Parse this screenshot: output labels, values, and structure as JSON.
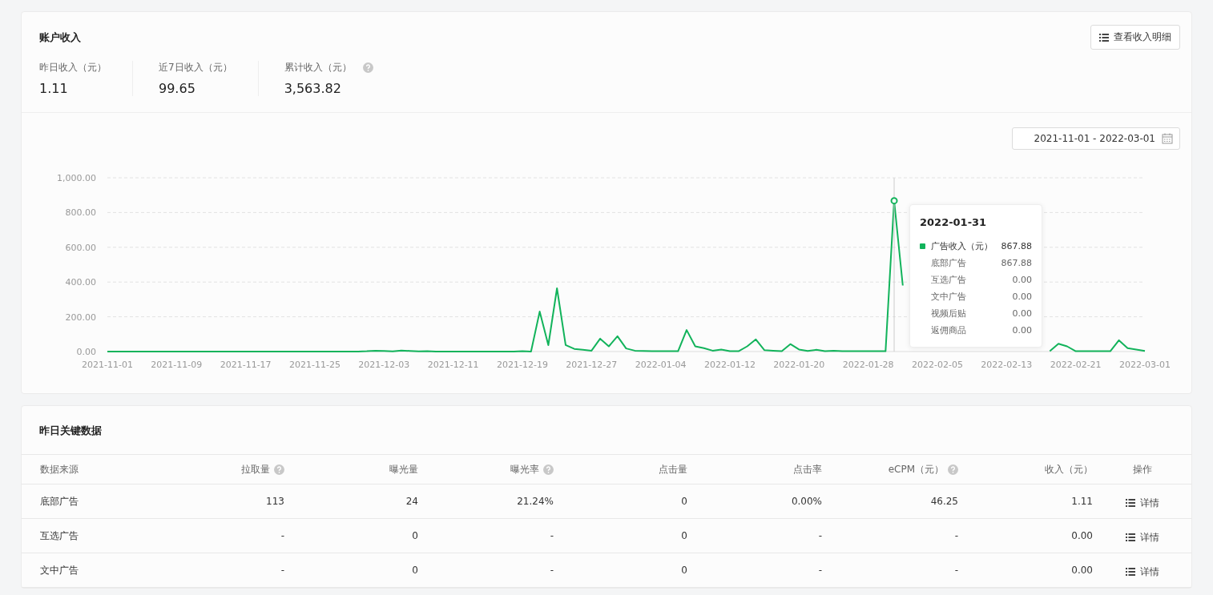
{
  "income_card": {
    "title": "账户收入",
    "detail_button": "查看收入明细",
    "stats": [
      {
        "label": "昨日收入（元）",
        "value": "1.11",
        "help": false
      },
      {
        "label": "近7日收入（元）",
        "value": "99.65",
        "help": false
      },
      {
        "label": "累计收入（元）",
        "value": "3,563.82",
        "help": true
      }
    ],
    "date_range": "2021-11-01 - 2022-03-01",
    "chart_data": {
      "type": "line",
      "ylim": [
        0,
        1000
      ],
      "grid": true,
      "yticks": [
        {
          "value": 0,
          "label": "0.00"
        },
        {
          "value": 200,
          "label": "200.00"
        },
        {
          "value": 400,
          "label": "400.00"
        },
        {
          "value": 600,
          "label": "600.00"
        },
        {
          "value": 800,
          "label": "800.00"
        },
        {
          "value": 1000,
          "label": "1,000.00"
        }
      ],
      "categories": [
        "2021-11-01",
        null,
        null,
        null,
        null,
        null,
        null,
        null,
        "2021-11-09",
        null,
        null,
        null,
        null,
        null,
        null,
        null,
        "2021-11-17",
        null,
        null,
        null,
        null,
        null,
        null,
        null,
        "2021-11-25",
        null,
        null,
        null,
        null,
        null,
        null,
        null,
        "2021-12-03",
        null,
        null,
        null,
        null,
        null,
        null,
        null,
        "2021-12-11",
        null,
        null,
        null,
        null,
        null,
        null,
        null,
        "2021-12-19",
        null,
        null,
        null,
        null,
        null,
        null,
        null,
        "2021-12-27",
        null,
        null,
        null,
        null,
        null,
        null,
        null,
        "2022-01-04",
        null,
        null,
        null,
        null,
        null,
        null,
        null,
        "2022-01-12",
        null,
        null,
        null,
        null,
        null,
        null,
        null,
        "2022-01-20",
        null,
        null,
        null,
        null,
        null,
        null,
        null,
        "2022-01-28",
        null,
        null,
        null,
        null,
        null,
        null,
        null,
        "2022-02-05",
        null,
        null,
        null,
        null,
        null,
        null,
        null,
        "2022-02-13",
        null,
        null,
        null,
        null,
        null,
        null,
        null,
        "2022-02-21",
        null,
        null,
        null,
        null,
        null,
        null,
        null,
        "2022-03-01"
      ],
      "series": [
        {
          "name": "广告收入（元）",
          "color": "#12b35b",
          "values": [
            0,
            0,
            0,
            0,
            0,
            0,
            0,
            0,
            0,
            0,
            0,
            0,
            0,
            0,
            0,
            0,
            0,
            0,
            0,
            0,
            0,
            0,
            0,
            0,
            0,
            0,
            0,
            0,
            0,
            0,
            2,
            5,
            3,
            1,
            6,
            3,
            1,
            2,
            0,
            0,
            0,
            0,
            0,
            0,
            0,
            0,
            0,
            0,
            2,
            0,
            230,
            37,
            364,
            38,
            15,
            10,
            5,
            74,
            30,
            88,
            18,
            5,
            3,
            2,
            2,
            2,
            2,
            124,
            30,
            20,
            5,
            12,
            2,
            2,
            30,
            70,
            8,
            5,
            2,
            43,
            12,
            3,
            10,
            2,
            5,
            2,
            2,
            2,
            2,
            2,
            2,
            867.88,
            380,
            null,
            null,
            null,
            null,
            null,
            null,
            null,
            null,
            null,
            null,
            null,
            null,
            null,
            null,
            null,
            null,
            2,
            45,
            30,
            2,
            2,
            2,
            2,
            2,
            65,
            20,
            12,
            3
          ]
        }
      ]
    },
    "tooltip": {
      "date": "2022-01-31",
      "rows": [
        {
          "kind": "series",
          "value": "867.88"
        },
        {
          "kind": "item",
          "label": "底部广告",
          "value": "867.88"
        },
        {
          "kind": "item",
          "label": "互选广告",
          "value": "0.00"
        },
        {
          "kind": "item",
          "label": "文中广告",
          "value": "0.00"
        },
        {
          "kind": "item",
          "label": "视频后贴",
          "value": "0.00"
        },
        {
          "kind": "item",
          "label": "返佣商品",
          "value": "0.00"
        }
      ]
    }
  },
  "key_data_card": {
    "title": "昨日关键数据",
    "columns": [
      {
        "label": "数据来源",
        "help": false
      },
      {
        "label": "拉取量",
        "help": true
      },
      {
        "label": "曝光量",
        "help": false
      },
      {
        "label": "曝光率",
        "help": true
      },
      {
        "label": "点击量",
        "help": false
      },
      {
        "label": "点击率",
        "help": false
      },
      {
        "label": "eCPM（元）",
        "help": true
      },
      {
        "label": "收入（元）",
        "help": false
      },
      {
        "label": "操作",
        "help": false
      }
    ],
    "rows": [
      {
        "cells": [
          "底部广告",
          "113",
          "24",
          "21.24%",
          "0",
          "0.00%",
          "46.25",
          "1.11"
        ],
        "action": "详情"
      },
      {
        "cells": [
          "互选广告",
          "-",
          "0",
          "-",
          "0",
          "-",
          "-",
          "0.00"
        ],
        "action": "详情"
      },
      {
        "cells": [
          "文中广告",
          "-",
          "0",
          "-",
          "0",
          "-",
          "-",
          "0.00"
        ],
        "action": "详情"
      }
    ]
  }
}
